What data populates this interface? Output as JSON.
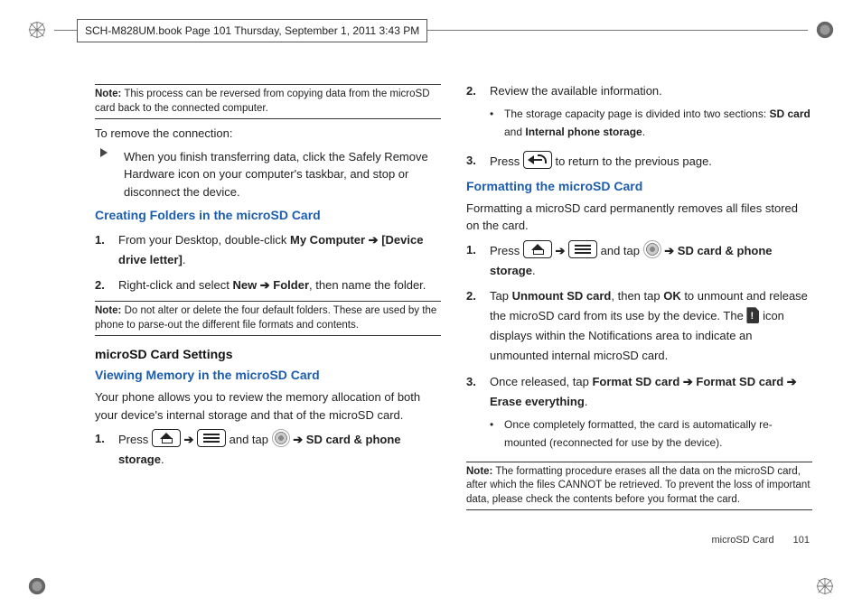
{
  "header": {
    "text": "SCH-M828UM.book  Page 101  Thursday, September 1, 2011  3:43 PM"
  },
  "footer": {
    "section": "microSD Card",
    "page": "101"
  },
  "left": {
    "note1_label": "Note:",
    "note1": "This process can be reversed from copying data from the microSD card back to the connected computer.",
    "remove_intro": "To remove the connection:",
    "remove_step": "When you finish transferring data, click the Safely Remove Hardware icon on your computer's taskbar, and stop or disconnect the device.",
    "h_creating": "Creating Folders in the microSD Card",
    "s1a": "From your Desktop, double-click ",
    "s1b": "My Computer ➔ [Device drive letter]",
    "s1c": ".",
    "s2a": "Right-click and select ",
    "s2b": "New ➔ Folder",
    "s2c": ", then name the folder.",
    "note2_label": "Note:",
    "note2": "Do not alter or delete the four default folders. These are used by the phone to parse-out the different file formats and contents.",
    "h_settings": "microSD Card Settings",
    "h_viewing": "Viewing Memory in the microSD Card",
    "view_p": "Your phone allows you to review the memory allocation of both your device's internal storage and that of the microSD card.",
    "v1_press": "Press ",
    "v1_andtap": " and tap ",
    "v1_end": "SD card & phone storage",
    "arrow": "➔",
    "dot": "."
  },
  "right": {
    "r2": "Review the available information.",
    "r2_b_a": "The storage capacity page is divided into two sections: ",
    "r2_b_b": "SD card",
    "r2_b_c": " and ",
    "r2_b_d": "Internal phone storage",
    "r2_b_e": ".",
    "r3_press": "Press ",
    "r3_end": " to return to the previous page.",
    "h_format": "Formatting the microSD Card",
    "format_p": "Formatting a microSD card permanently removes all files stored on the card.",
    "f1_press": "Press ",
    "f1_andtap": " and tap ",
    "f1_end": "SD card & phone storage",
    "f2a": "Tap ",
    "f2b": "Unmount SD card",
    "f2c": ", then tap ",
    "f2d": "OK",
    "f2e": " to unmount and release the microSD card from its use by the device. The ",
    "f2f": " icon displays within the Notifications area to indicate an unmounted internal microSD card.",
    "f3a": "Once released, tap ",
    "f3b": "Format SD card ➔ Format SD card ➔ Erase everything",
    "f3c": ".",
    "f3_bullet": "Once completely formatted, the card is automatically re-mounted (reconnected for use by the device).",
    "note3_label": "Note:",
    "note3": "The formatting procedure erases all the data on the microSD card, after which the files CANNOT be retrieved. To prevent the loss of important data, please check the contents before you format the card."
  }
}
